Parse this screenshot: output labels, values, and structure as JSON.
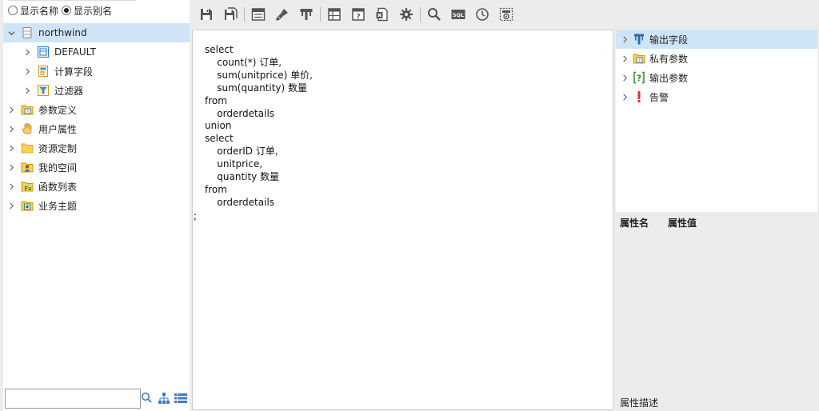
{
  "display_options": {
    "show_name": "显示名称",
    "show_alias": "显示别名",
    "selected": "show_alias"
  },
  "tree": {
    "root": "northwind",
    "children": [
      "DEFAULT",
      "计算字段",
      "过滤器"
    ],
    "items": [
      "参数定义",
      "用户属性",
      "资源定制",
      "我的空间",
      "函数列表",
      "业务主题"
    ]
  },
  "search": {
    "value": "",
    "placeholder": ""
  },
  "toolbar": {
    "buttons": [
      "save-icon",
      "save-as-icon",
      "layout-icon",
      "clear-icon",
      "field-icon",
      "table-icon",
      "param-icon",
      "excel-icon",
      "gear-icon",
      "search-icon",
      "sql-icon",
      "clock-icon",
      "settings-icon"
    ],
    "sql_label": "SQL"
  },
  "editor": {
    "lines": [
      "select",
      "    count(*) 订单,",
      "    sum(unitprice) 单价,",
      "    sum(quantity) 数量",
      "from",
      "    orderdetails",
      "union",
      "select",
      "    orderID 订单,",
      "    unitprice,",
      "    quantity 数量",
      "from",
      "    orderdetails"
    ],
    "stray_char": ";"
  },
  "right_panel": {
    "items": [
      "输出字段",
      "私有参数",
      "输出参数",
      "告警"
    ],
    "props_header": {
      "name": "属性名",
      "value": "属性值"
    },
    "props_desc": "属性描述"
  },
  "colors": {
    "selection": "#cfe5f7",
    "panel_bg": "#ececec"
  }
}
